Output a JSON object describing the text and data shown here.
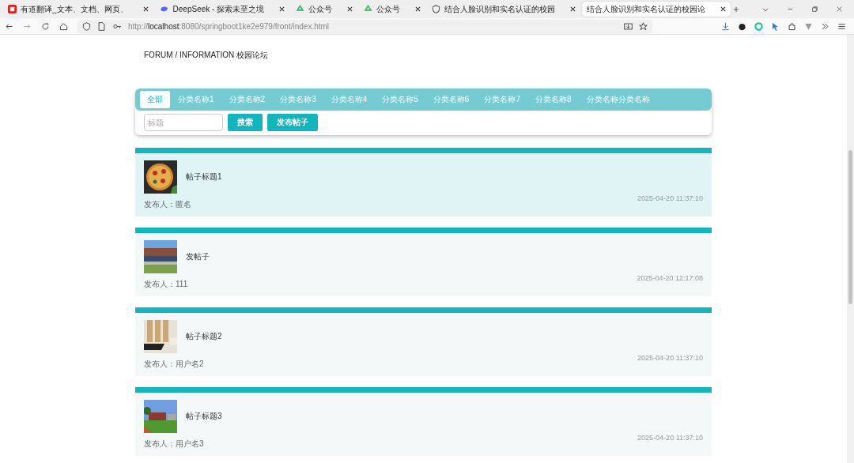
{
  "browser": {
    "tabs": [
      {
        "title": "有道翻译_文本、文档、网页、",
        "selected": false
      },
      {
        "title": "DeepSeek - 探索未至之境",
        "selected": false
      },
      {
        "title": "公众号",
        "selected": false
      },
      {
        "title": "公众号",
        "selected": false
      },
      {
        "title": "结合人脸识别和实名认证的校园",
        "selected": false
      },
      {
        "title": "结合人脸识别和实名认证的校园论",
        "selected": true
      }
    ],
    "url": "http://**localhost**:8080/springboot1ke2e979/front/index.html"
  },
  "page": {
    "breadcrumb": "FORUM / INFORMATION 校园论坛",
    "categories": [
      {
        "label": "全部",
        "selected": true
      },
      {
        "label": "分类名称1",
        "selected": false
      },
      {
        "label": "分类名称2",
        "selected": false
      },
      {
        "label": "分类名称3",
        "selected": false
      },
      {
        "label": "分类名称4",
        "selected": false
      },
      {
        "label": "分类名称5",
        "selected": false
      },
      {
        "label": "分类名称6",
        "selected": false
      },
      {
        "label": "分类名称7",
        "selected": false
      },
      {
        "label": "分类名称8",
        "selected": false
      },
      {
        "label": "分类名称分类名称",
        "selected": false
      }
    ],
    "search": {
      "placeholder": "标题"
    },
    "buttons": [
      "搜索",
      "发布帖子"
    ],
    "posts": [
      {
        "title": "帖子标题1",
        "author": "发布人：匿名",
        "time": "2025-04-20 11:37:10",
        "highlighted": true
      },
      {
        "title": "发帖子",
        "author": "发布人：111",
        "time": "2025-04-20 12:17:08",
        "highlighted": false
      },
      {
        "title": "帖子标题2",
        "author": "发布人：用户名2",
        "time": "2025-04-20 11:37:10",
        "highlighted": false
      },
      {
        "title": "帖子标题3",
        "author": "发布人：用户名3",
        "time": "2025-04-20 11:37:10",
        "highlighted": false
      }
    ]
  }
}
